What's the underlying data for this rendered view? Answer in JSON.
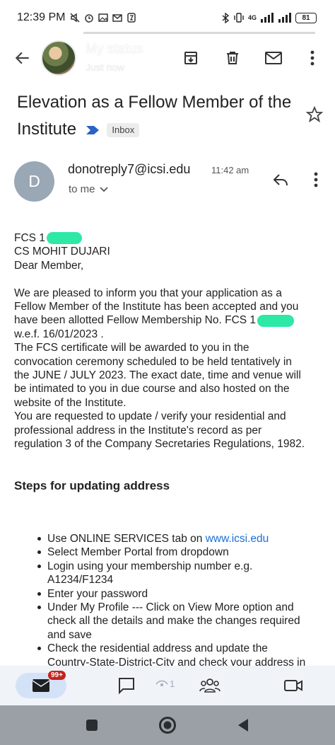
{
  "status_bar": {
    "time": "12:39 PM",
    "network": "4G",
    "battery": "81"
  },
  "app_bar": {
    "status_title": "My status",
    "status_subtitle": "Just now"
  },
  "email": {
    "subject": "Elevation as a Fellow Member of the Institute",
    "label": "Inbox",
    "sender_initial": "D",
    "sender": "donotreply7@icsi.edu",
    "time": "11:42 am",
    "recipient": "to me",
    "body": {
      "fcs_prefix": "FCS 1",
      "name": "CS MOHIT DUJARI",
      "greeting": "Dear Member,",
      "lines": [
        "We are pleased to inform you that your application as a",
        "Fellow Member of the Institute has been accepted and you",
        "have been allotted Fellow Membership No. FCS 1",
        "w.e.f. 16/01/2023 .",
        "The FCS certificate will be awarded to you in the",
        "convocation ceremony scheduled to be held tentatively in",
        "the JUNE / JULY 2023. The exact date, time and venue will",
        "be intimated to you in due course and also hosted on the",
        "website of the Institute.",
        "You are requested to update / verify your residential and",
        "professional address in the Institute's record as per",
        "regulation 3 of the Company Secretaries Regulations, 1982."
      ]
    },
    "steps_heading": "Steps for updating address",
    "steps": {
      "s1_prefix": "Use ONLINE SERVICES tab on ",
      "s1_link": "www.icsi.edu",
      "s2": "Select Member Portal from dropdown",
      "s3a": "Login using your membership number e.g.",
      "s3b": "A1234/F1234",
      "s4": "Enter your password",
      "s5a": "Under My Profile --- Click on View More option and",
      "s5b": "check all the details and make the changes required",
      "s5c": "and save",
      "s6a": "Check the residential address and update the",
      "s6b": "Country-State-District-City and check your address in"
    }
  },
  "bottom_nav": {
    "mail_badge": "99+",
    "camera_count": "1"
  },
  "colors": {
    "accent": "#1a6fd6",
    "badge": "#c5221f",
    "redaction": "#2ee8a5",
    "avatar": "#9aa7b4",
    "nav_pill": "#d4e2f8"
  }
}
